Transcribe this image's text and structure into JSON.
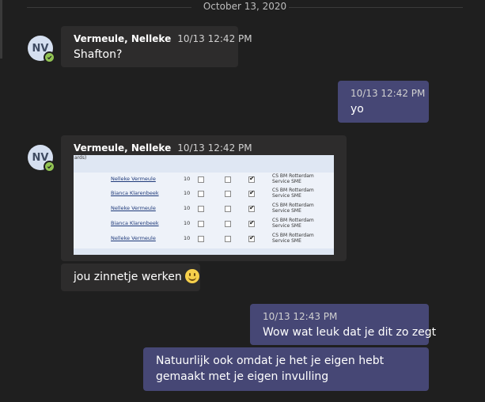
{
  "date_divider": "October 13, 2020",
  "messages": [
    {
      "sender": "Vermeule, Nelleke",
      "initials": "NV",
      "time": "10/13 12:42 PM",
      "text": "Shafton?"
    },
    {
      "time": "10/13 12:42 PM",
      "text": "yo"
    },
    {
      "sender": "Vermeule, Nelleke",
      "initials": "NV",
      "time": "10/13 12:42 PM",
      "image": {
        "corner_text": "ards)",
        "rows": [
          {
            "name": "Nelleke Vermeule",
            "num": "10",
            "team": [
              "CS BM Rotterdam",
              "Service SME"
            ]
          },
          {
            "name": "Bianca Klarenbeek",
            "num": "10",
            "team": [
              "CS BM Rotterdam",
              "Service SME"
            ]
          },
          {
            "name": "Nelleke Vermeule",
            "num": "10",
            "team": [
              "CS BM Rotterdam",
              "Service SME"
            ]
          },
          {
            "name": "Bianca Klarenbeek",
            "num": "10",
            "team": [
              "CS BM Rotterdam",
              "Service SME"
            ]
          },
          {
            "name": "Nelleke Vermeule",
            "num": "10",
            "team": [
              "CS BM Rotterdam",
              "Service SME"
            ]
          }
        ]
      }
    },
    {
      "text": "jou zinnetje werken",
      "emoji": "slightly-smiling-face-icon"
    },
    {
      "time": "10/13 12:43 PM",
      "text": "Wow wat leuk dat je dit zo zegt"
    },
    {
      "text": "Natuurlijk ook omdat je het je eigen hebt gemaakt met je eigen invulling"
    }
  ],
  "colors": {
    "background": "#1f1f1f",
    "incoming_bubble": "#2d2c2c",
    "outgoing_bubble": "#464775",
    "presence_available": "#92c353"
  }
}
